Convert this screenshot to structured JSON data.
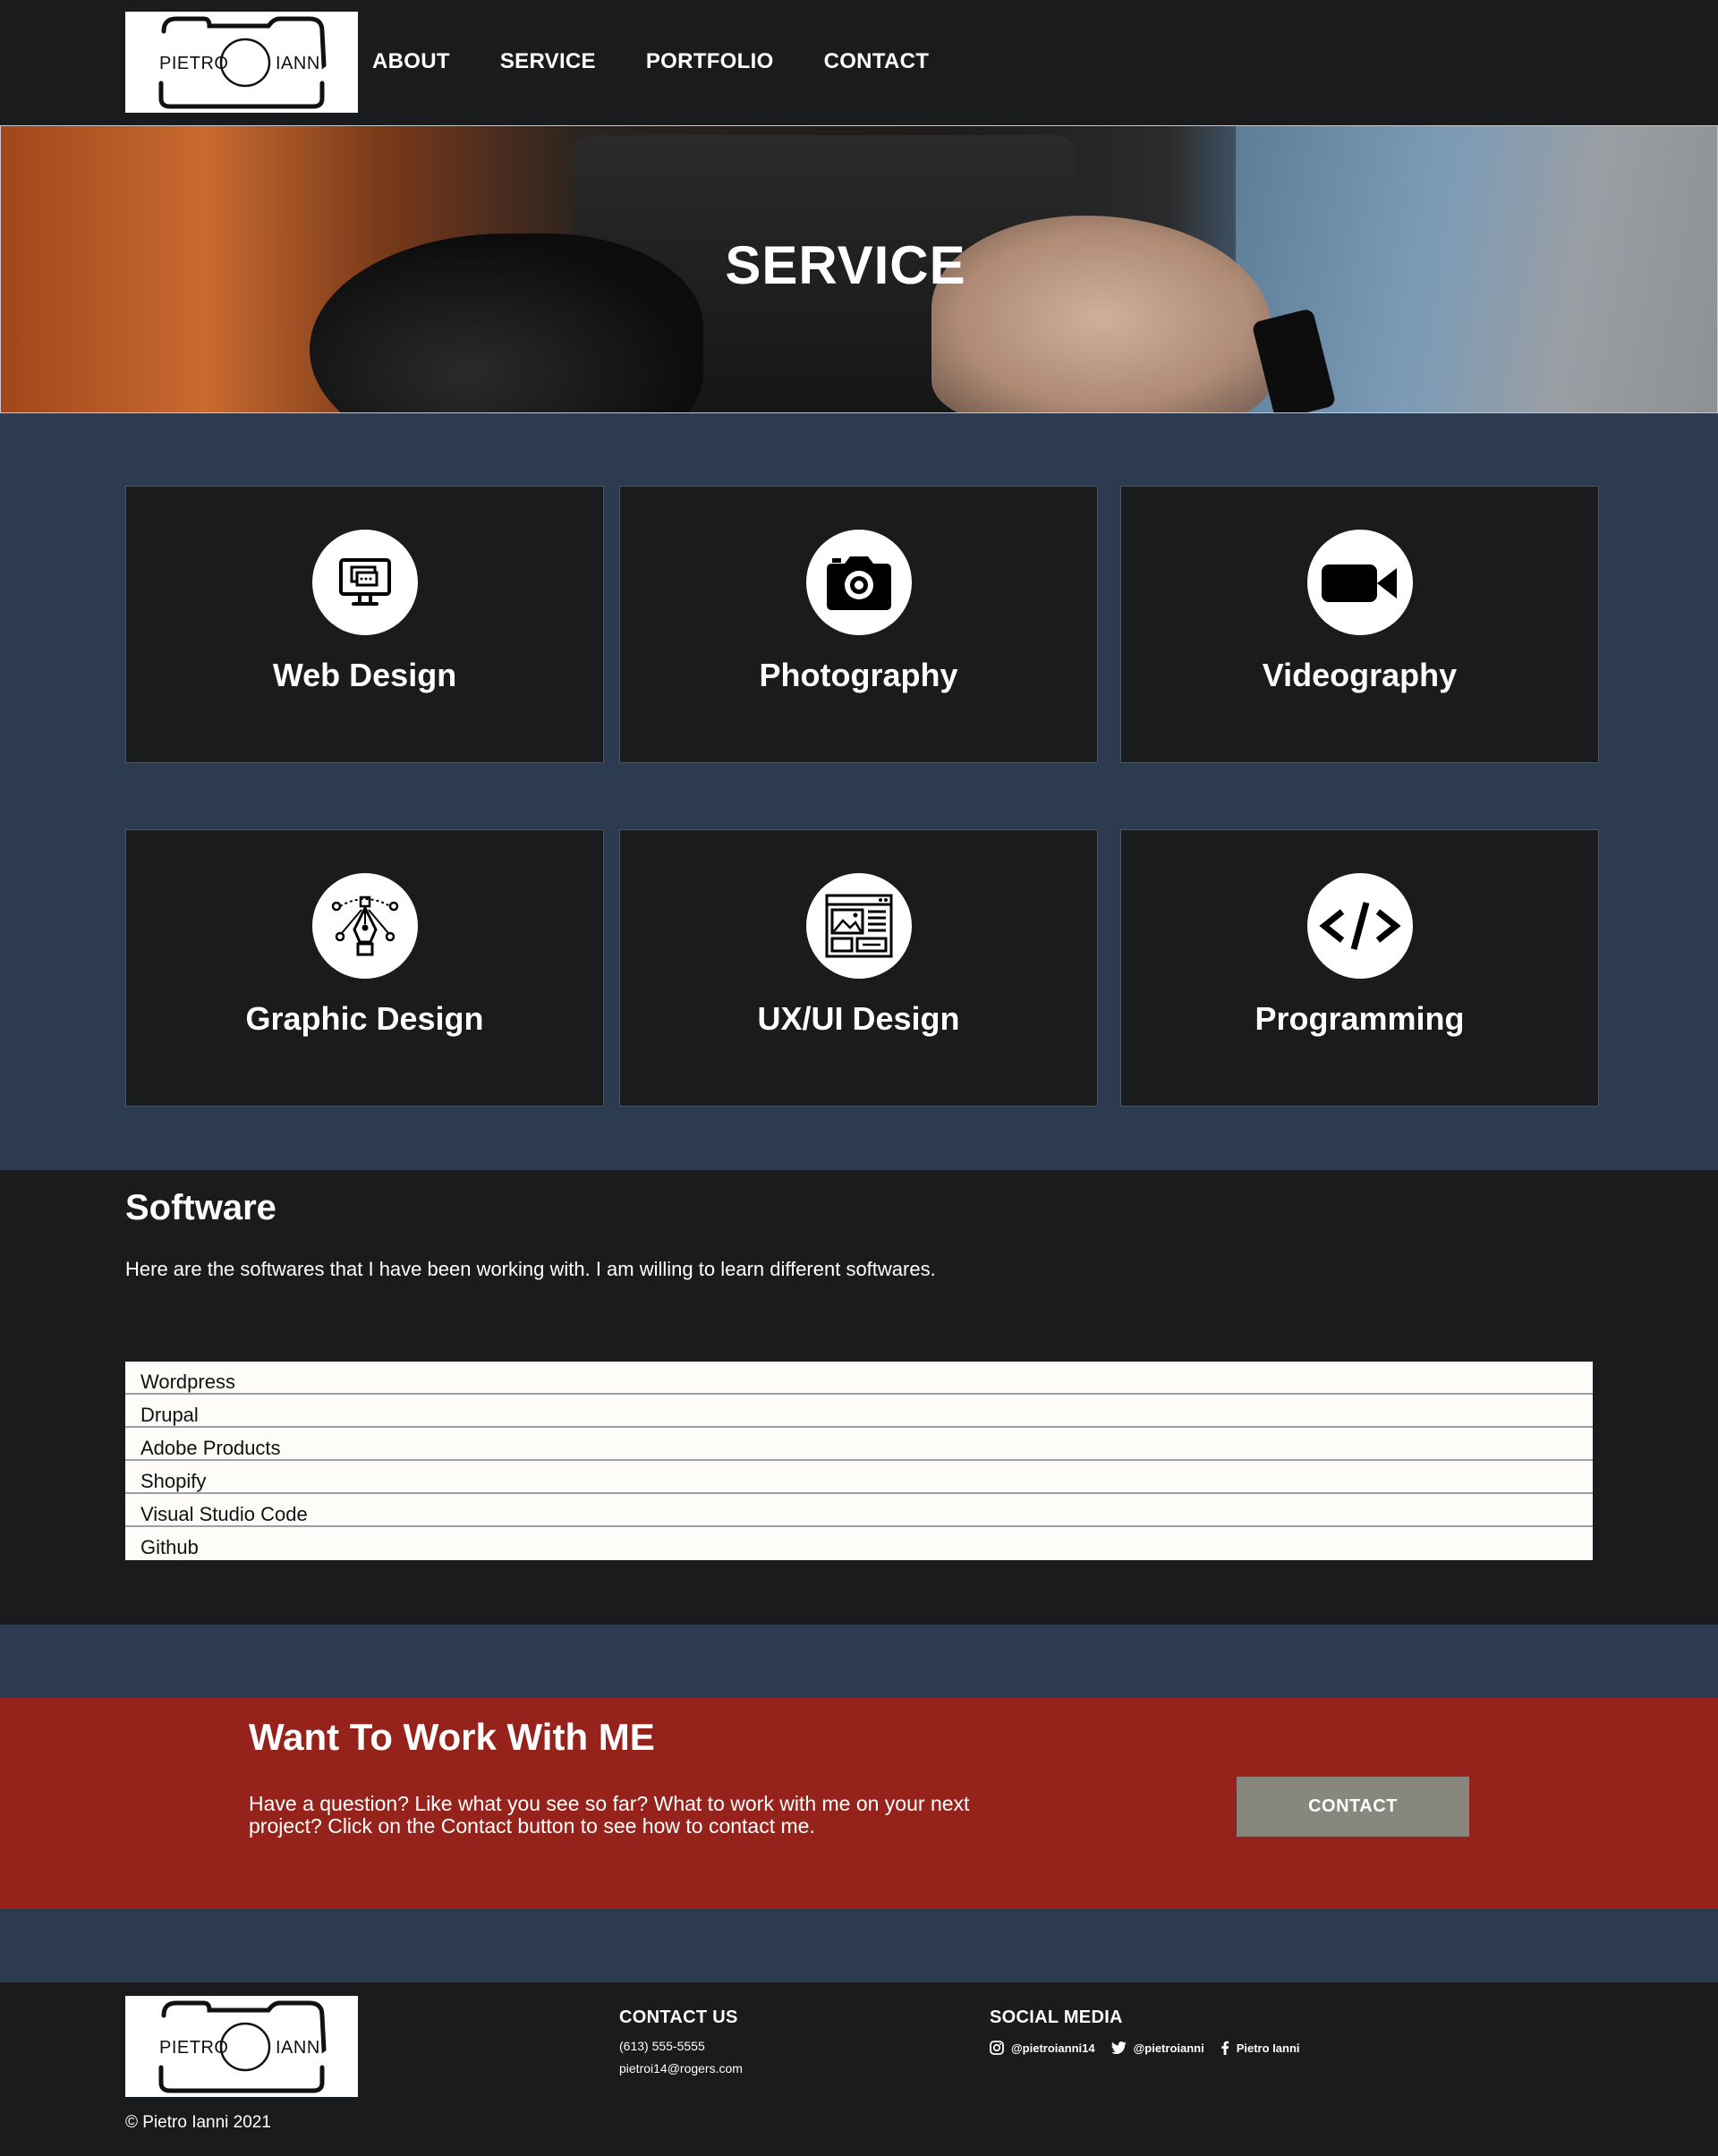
{
  "header": {
    "logo": {
      "left_text": "PIETRO",
      "right_text": "IANNI"
    },
    "nav": [
      "ABOUT",
      "SERVICE",
      "PORTFOLIO",
      "CONTACT"
    ]
  },
  "hero": {
    "title": "SERVICE"
  },
  "services": [
    {
      "label": "Web Design",
      "icon": "monitor-icon"
    },
    {
      "label": "Photography",
      "icon": "camera-icon"
    },
    {
      "label": "Videography",
      "icon": "video-camera-icon"
    },
    {
      "label": "Graphic Design",
      "icon": "pen-tool-icon"
    },
    {
      "label": "UX/UI Design",
      "icon": "wireframe-icon"
    },
    {
      "label": "Programming",
      "icon": "code-icon"
    }
  ],
  "software": {
    "title": "Software",
    "description": "Here are the softwares that I have been working with. I am willing to learn different softwares.",
    "items": [
      "Wordpress",
      "Drupal",
      "Adobe Products",
      "Shopify",
      "Visual Studio Code",
      "Github"
    ]
  },
  "cta": {
    "title": "Want To Work With ME",
    "text": "Have a question? Like what you see so far? What to work with me on your next project? Click on the Contact button to see how to contact me.",
    "button": "CONTACT"
  },
  "footer": {
    "logo": {
      "left_text": "PIETRO",
      "right_text": "IANNI"
    },
    "copyright": "© Pietro Ianni 2021",
    "contact": {
      "title": "CONTACT US",
      "phone": "(613) 555-5555",
      "email": "pietroi14@rogers.com"
    },
    "social": {
      "title": "SOCIAL MEDIA",
      "instagram": "@pietroianni14",
      "twitter": "@pietroianni",
      "facebook": "Pietro Ianni"
    }
  },
  "colors": {
    "dark": "#1a1b1c",
    "navy": "#2c3b4f",
    "cta_red": "#96231b",
    "button_gray": "#87877e"
  }
}
